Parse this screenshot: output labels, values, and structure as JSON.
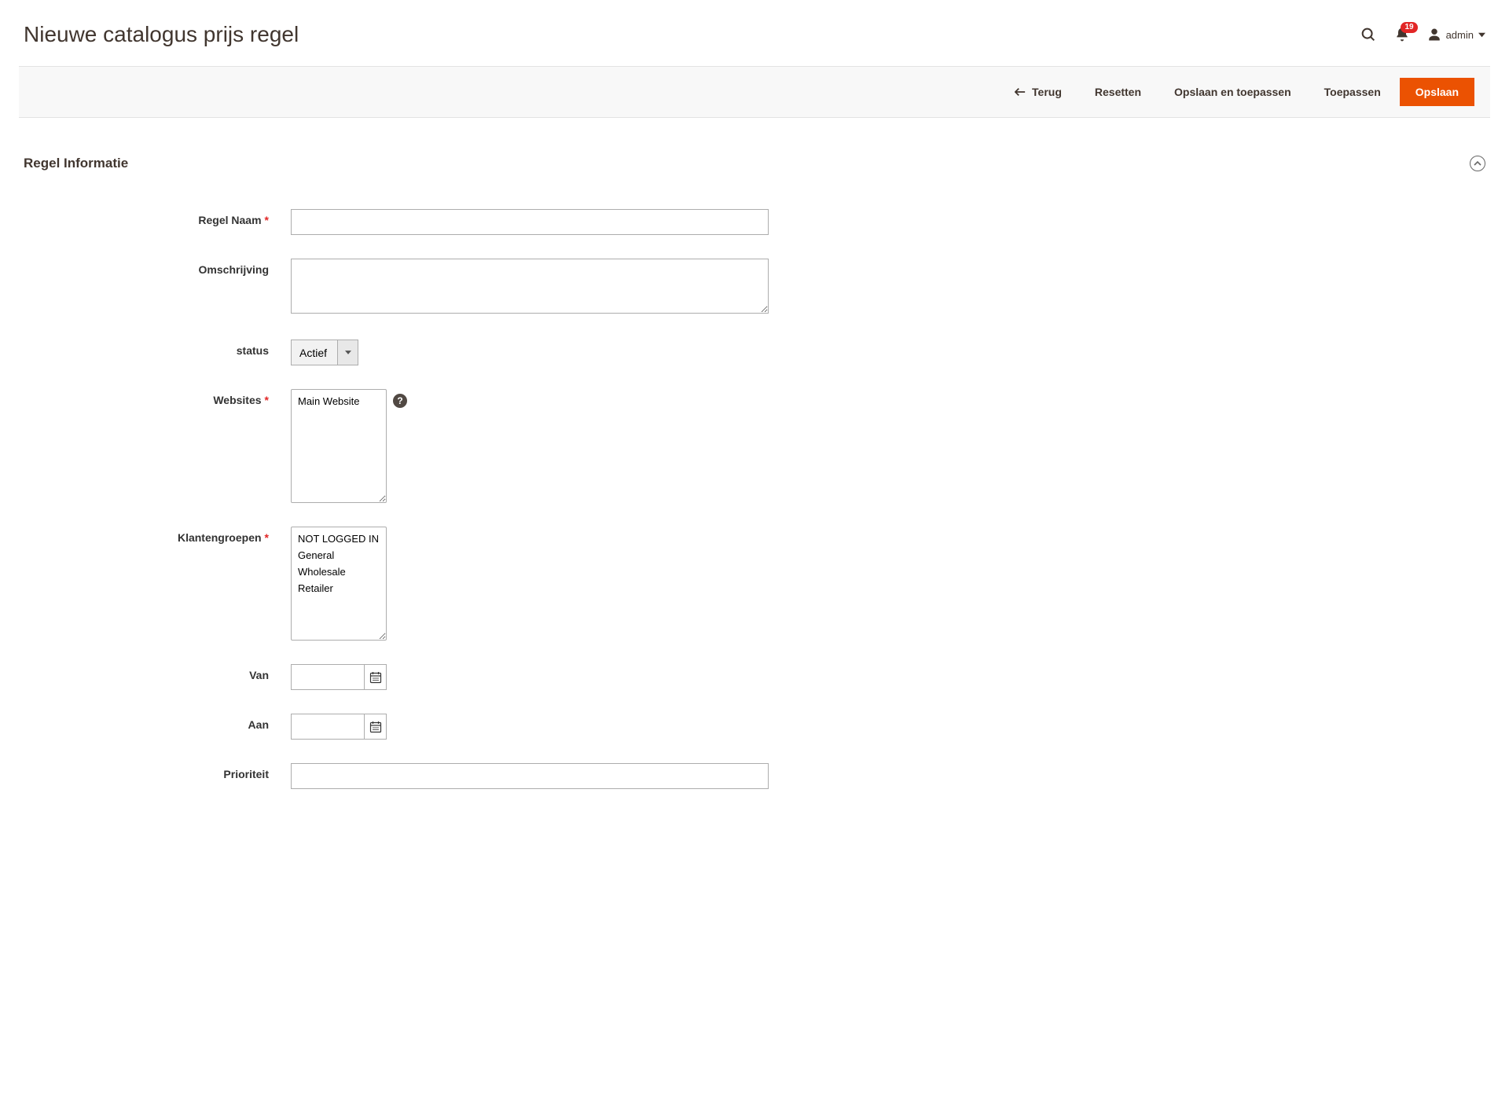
{
  "header": {
    "title": "Nieuwe catalogus prijs regel",
    "notification_count": "19",
    "admin_label": "admin"
  },
  "actions": {
    "back": "Terug",
    "reset": "Resetten",
    "save_apply": "Opslaan en toepassen",
    "apply": "Toepassen",
    "save": "Opslaan"
  },
  "section": {
    "title": "Regel Informatie"
  },
  "fields": {
    "rule_name": {
      "label": "Regel Naam",
      "value": "",
      "required": true
    },
    "description": {
      "label": "Omschrijving",
      "value": ""
    },
    "status": {
      "label": "status",
      "selected": "Actief",
      "options": [
        "Actief"
      ]
    },
    "websites": {
      "label": "Websites",
      "required": true,
      "options": [
        "Main Website"
      ]
    },
    "customer_groups": {
      "label": "Klantengroepen",
      "required": true,
      "options": [
        "NOT LOGGED IN",
        "General",
        "Wholesale",
        "Retailer"
      ]
    },
    "from": {
      "label": "Van",
      "value": ""
    },
    "to": {
      "label": "Aan",
      "value": ""
    },
    "priority": {
      "label": "Prioriteit",
      "value": ""
    }
  }
}
